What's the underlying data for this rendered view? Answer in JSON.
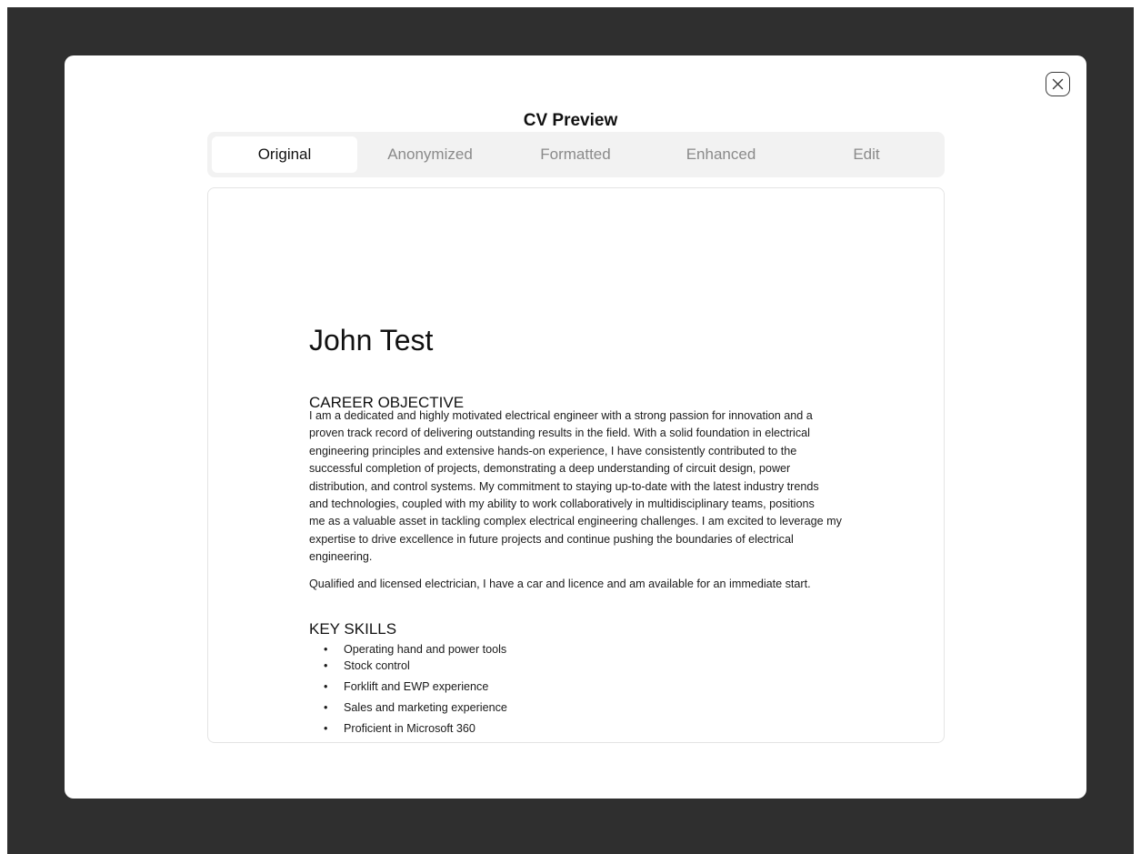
{
  "modal": {
    "title": "CV Preview",
    "close_icon": "close-icon"
  },
  "tabs": [
    {
      "label": "Original",
      "active": true
    },
    {
      "label": "Anonymized",
      "active": false
    },
    {
      "label": "Formatted",
      "active": false
    },
    {
      "label": "Enhanced",
      "active": false
    },
    {
      "label": "Edit",
      "active": false
    }
  ],
  "cv": {
    "name": "John Test",
    "career_objective_heading": "CAREER OBJECTIVE",
    "career_objective_lines": [
      "I am a dedicated and highly motivated electrical engineer with a strong passion for innovation and a",
      "proven track record of delivering outstanding results in the field. With a solid foundation in electrical",
      "engineering principles and extensive hands-on experience, I have consistently contributed to the",
      "successful completion of projects, demonstrating a deep understanding of circuit design, power",
      "distribution, and control systems. My commitment to staying up-to-date with the latest industry trends",
      "and technologies, coupled with my ability to work collaboratively in multidisciplinary teams, positions",
      "me as a valuable asset in tackling complex electrical engineering challenges. I am excited to leverage my",
      "expertise to drive excellence in future projects and continue pushing the boundaries of electrical",
      "engineering."
    ],
    "second_paragraph": "Qualified and licensed electrician, I have a car and licence and am available for an immediate start.",
    "key_skills_heading": "KEY SKILLS",
    "bullet": "•",
    "key_skills": [
      "Operating hand and power tools",
      "Stock control",
      "Forklift and EWP experience",
      "Sales and marketing experience",
      "Proficient in Microsoft 360"
    ]
  },
  "colors": {
    "backdrop": "#2f2f2f",
    "modal_bg": "#ffffff",
    "tab_bar_bg": "#f2f2f2",
    "tab_inactive_text": "#8a8a8a",
    "tab_active_text": "#111111"
  }
}
